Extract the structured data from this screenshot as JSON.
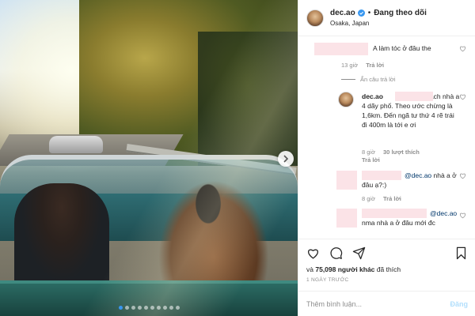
{
  "post": {
    "carousel_total": 10,
    "carousel_active": 0
  },
  "header": {
    "username": "dec.ao",
    "separator": "•",
    "follow_status": "Đang theo dõi",
    "location": "Osaka, Japan"
  },
  "comments": [
    {
      "text": "A làm tóc ở đâu the",
      "time": "13 giờ",
      "reply_label": "Trả lời"
    }
  ],
  "replies_toggle": "Ẩn câu trả lời",
  "reply": {
    "username": "dec.ao",
    "text": "cách nhà a 4 dãy phố. Theo ước chừng là 1,6km. Đến ngã tư thứ 4 rẽ trái đi 400m là tới e ơi",
    "time": "8 giờ",
    "likes": "30 lượt thích",
    "reply_label": "Trả lời"
  },
  "comment2": {
    "mention": "@dec.ao",
    "text": " nhà a ở đâu ạ?:)",
    "time": "8 giờ",
    "reply_label": "Trả lời"
  },
  "comment3": {
    "mention": "@dec.ao",
    "text": "nma nhà a ở đâu mới đc"
  },
  "likes": {
    "prefix": "và",
    "count": "75,098",
    "middle": "người khác",
    "suffix": "đã thích"
  },
  "posted_time": "1 NGÀY TRƯỚC",
  "add_comment": {
    "placeholder": "Thêm bình luận...",
    "post_label": "Đăng"
  },
  "colors": {
    "accent": "#3897f0",
    "text": "#262626",
    "muted": "#8e8e8e",
    "redaction": "#fbe3e7",
    "post_disabled": "#b2dffc"
  }
}
